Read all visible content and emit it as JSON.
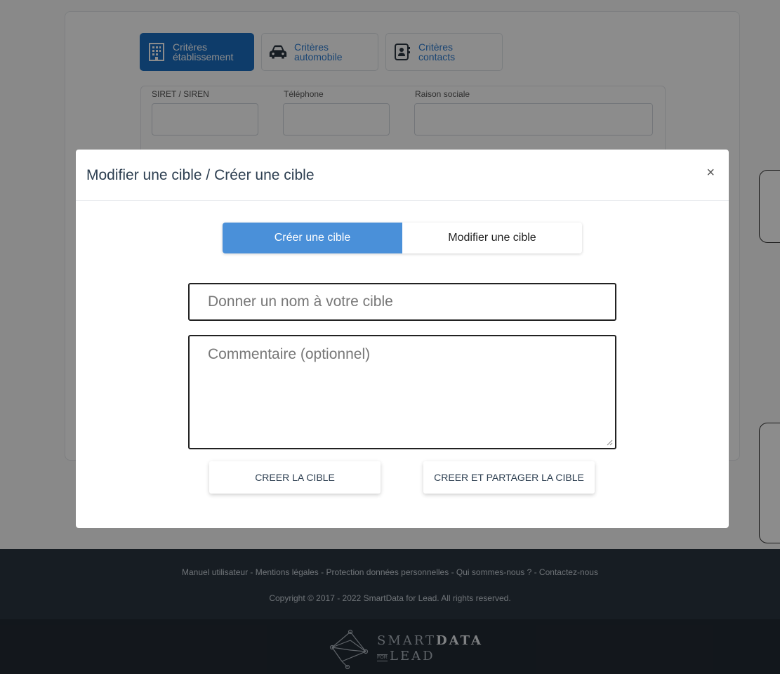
{
  "background": {
    "tabs": [
      {
        "line1": "Critères",
        "line2": "établissement",
        "icon": "building-icon"
      },
      {
        "line1": "Critères",
        "line2": "automobile",
        "icon": "car-icon"
      },
      {
        "line1": "Critères",
        "line2": "contacts",
        "icon": "contact-card-icon"
      }
    ],
    "fields": [
      {
        "label": "SIRET / SIREN"
      },
      {
        "label": "Téléphone"
      },
      {
        "label": "Raison sociale"
      }
    ]
  },
  "modal": {
    "title": "Modifier une cible / Créer une cible",
    "close_symbol": "×",
    "segment": {
      "create_label": "Créer une cible",
      "modify_label": "Modifier une cible",
      "active": "create"
    },
    "name_input": {
      "placeholder": "Donner un nom à votre cible",
      "value": ""
    },
    "comment_input": {
      "placeholder": "Commentaire (optionnel)",
      "value": ""
    },
    "buttons": {
      "create": "CREER LA CIBLE",
      "create_share": "CREER ET PARTAGER LA CIBLE"
    }
  },
  "footer": {
    "links": "Manuel utilisateur - Mentions légales - Protection données personnelles - Qui sommes-nous ? - Contactez-nous",
    "copyright": "Copyright © 2017 - 2022 SmartData for Lead. All rights reserved.",
    "logo": {
      "smart": "SMART",
      "data": "DATA",
      "for": "FOR",
      "lead": "LEAD"
    }
  },
  "colors": {
    "accent": "#4a90d9",
    "tab_active": "#1b6ec2",
    "footer_top": "#2b3540",
    "footer_bottom": "#222a33"
  }
}
